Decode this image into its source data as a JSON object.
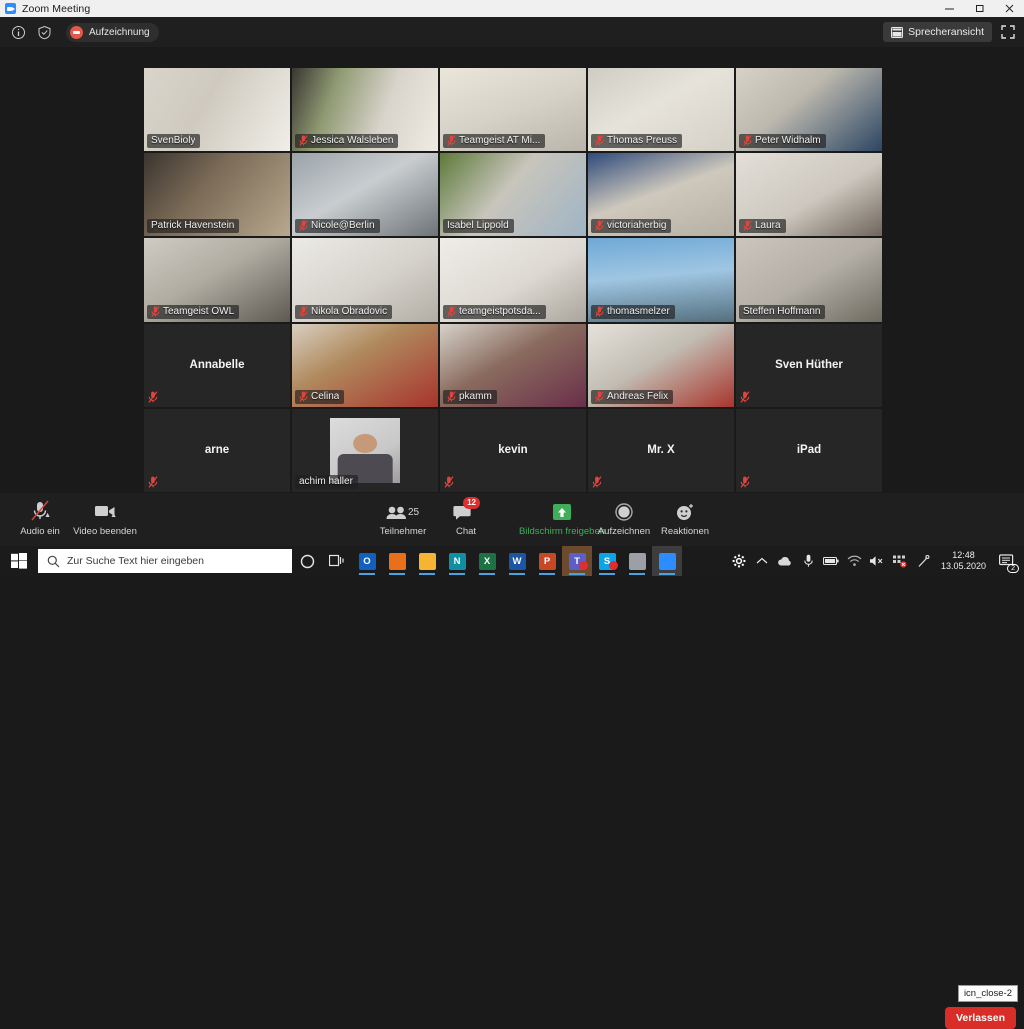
{
  "window": {
    "title": "Zoom Meeting",
    "app_icon": "zoom-icon",
    "minimize": "minimize-icon",
    "maximize": "maximize-icon",
    "close": "close-icon"
  },
  "topbar": {
    "info_icon": "info-icon",
    "shield_icon": "shield-icon",
    "recording_label": "Aufzeichnung",
    "speaker_view_label": "Sprecheransicht",
    "fullscreen_icon": "fullscreen-icon"
  },
  "grid": {
    "columns": 5,
    "rows": 5,
    "active_speaker": "Isabel Lippold",
    "active_border_color": "#b4e832",
    "tiles": [
      {
        "name": "SvenBioly",
        "muted": false,
        "video": true,
        "bg": "linear-gradient(120deg,#d9d5cc 0%,#cfcabf 42%,#f0eee8 100%)"
      },
      {
        "name": "Jessica Walsleben",
        "muted": true,
        "video": true,
        "bg": "linear-gradient(110deg,#3a3632 0%,#8f9a72 28%,#d8d3cb 62%,#efeae2 100%)"
      },
      {
        "name": "Teamgeist AT Mi...",
        "muted": true,
        "video": true,
        "bg": "linear-gradient(160deg,#eae6da 0%,#d6d2c8 50%,#b9b5ab 100%)"
      },
      {
        "name": "Thomas Preuss",
        "muted": true,
        "video": true,
        "bg": "linear-gradient(150deg,#cfccc4 0%,#e6e3db 45%,#d4d0c6 100%)"
      },
      {
        "name": "Peter Widhalm",
        "muted": true,
        "video": true,
        "bg": "linear-gradient(140deg,#d6d2c8 0%,#bdb9ae 40%,#2c4664 100%)"
      },
      {
        "name": "Patrick Havenstein",
        "muted": false,
        "video": true,
        "bg": "linear-gradient(130deg,#3b3530 0%,#7a6a56 40%,#b8a88e 100%)"
      },
      {
        "name": "Nicole@Berlin",
        "muted": true,
        "video": true,
        "bg": "linear-gradient(150deg,#9aa3a8 0%,#c9cdd0 45%,#6d7478 100%)"
      },
      {
        "name": "Isabel Lippold",
        "muted": false,
        "video": true,
        "active": true,
        "bg": "linear-gradient(130deg,#5d7a3a 0%,#c8c5bc 45%,#9fb4c4 100%)"
      },
      {
        "name": "victoriaherbig",
        "muted": true,
        "video": true,
        "bg": "linear-gradient(160deg,#2f4a7a 0%,#cfc9bd 48%,#b5afa4 100%)"
      },
      {
        "name": "Laura",
        "muted": true,
        "video": true,
        "bg": "linear-gradient(150deg,#e3dfd8 0%,#cdc8bf 55%,#6f655c 100%)"
      },
      {
        "name": "Teamgeist OWL",
        "muted": true,
        "video": true,
        "bg": "linear-gradient(150deg,#cfcbc2 0%,#b0aca2 45%,#5e5a52 100%)"
      },
      {
        "name": "Nikola Obradovic",
        "muted": true,
        "video": true,
        "bg": "linear-gradient(150deg,#eceae5 0%,#d5d2cb 55%,#b2aea5 100%)"
      },
      {
        "name": "teamgeistpotsda...",
        "muted": true,
        "video": true,
        "bg": "linear-gradient(150deg,#efede8 0%,#ddd9d2 55%,#a9a59c 100%)"
      },
      {
        "name": "thomasmelzer",
        "muted": true,
        "video": true,
        "bg": "linear-gradient(175deg,#6fa8d6 0%,#9fc6e2 45%,#54707f 100%)"
      },
      {
        "name": "Steffen Hoffmann",
        "muted": false,
        "video": true,
        "bg": "linear-gradient(150deg,#cbc6bd 0%,#b4afa6 50%,#6d6a60 100%)"
      },
      {
        "name": "Annabelle",
        "muted": true,
        "video": false
      },
      {
        "name": "Celina",
        "muted": true,
        "video": true,
        "bg": "linear-gradient(150deg,#d8cfc0 0%,#b08a5e 40%,#a8342c 100%)"
      },
      {
        "name": "pkamm",
        "muted": true,
        "video": true,
        "bg": "linear-gradient(150deg,#d6d2ca 0%,#8a6b5e 45%,#6a2f4a 100%)"
      },
      {
        "name": "Andreas Felix",
        "muted": true,
        "video": true,
        "bg": "linear-gradient(150deg,#e6e2da 0%,#c2bdb3 45%,#a8352c 100%)"
      },
      {
        "name": "Sven Hüther",
        "muted": true,
        "video": false
      },
      {
        "name": "arne",
        "muted": true,
        "video": false
      },
      {
        "name": "achim haller",
        "muted": false,
        "video": true,
        "avatar": true,
        "bg": "linear-gradient(150deg,#dcdcdc 0%,#c8c8c8 60%,#9d9d9d 100%)"
      },
      {
        "name": "kevin",
        "muted": true,
        "video": false
      },
      {
        "name": "Mr. X",
        "muted": true,
        "video": false
      },
      {
        "name": "iPad",
        "muted": true,
        "video": false
      }
    ]
  },
  "toolbar": {
    "audio_label": "Audio ein",
    "audio_icon": "mic-off-icon",
    "video_label": "Video beenden",
    "video_icon": "camera-icon",
    "participants_label": "Teilnehmer",
    "participants_count": "25",
    "participants_icon": "people-icon",
    "chat_label": "Chat",
    "chat_icon": "chat-icon",
    "chat_badge": "12",
    "share_label": "Bildschirm freigeben",
    "share_icon": "share-screen-icon",
    "share_color": "#3fae5a",
    "record_label": "Aufzeichnen",
    "record_icon": "record-icon",
    "reactions_label": "Reaktionen",
    "reactions_icon": "smiley-icon",
    "leave_label": "Verlassen",
    "tooltip": "icn_close-2"
  },
  "taskbar": {
    "start_icon": "windows-start-icon",
    "search_placeholder": "Zur Suche Text hier eingeben",
    "search_icon": "search-icon",
    "cortana_icon": "cortana-icon",
    "taskview_icon": "task-view-icon",
    "apps": [
      {
        "name": "outlook-icon",
        "glyph": "O",
        "color": "#1160bf",
        "running": true
      },
      {
        "name": "firefox-icon",
        "glyph": "",
        "color": "#e8701a",
        "running": true
      },
      {
        "name": "file-explorer-icon",
        "glyph": "",
        "color": "#f5b431",
        "running": true
      },
      {
        "name": "onenote-icon",
        "glyph": "N",
        "color": "#0f8fa3",
        "running": true
      },
      {
        "name": "excel-icon",
        "glyph": "X",
        "color": "#1d7245",
        "running": true
      },
      {
        "name": "word-icon",
        "glyph": "W",
        "color": "#1b55a5",
        "running": true
      },
      {
        "name": "powerpoint-icon",
        "glyph": "P",
        "color": "#c84724",
        "running": true
      },
      {
        "name": "teams-icon",
        "glyph": "T",
        "color": "#5b5fc7",
        "running": true,
        "badge": true,
        "highlight": true
      },
      {
        "name": "skype-icon",
        "glyph": "S",
        "color": "#0aa5e8",
        "running": true,
        "badge": true
      },
      {
        "name": "ppt-window-icon",
        "glyph": "",
        "color": "#9aa0a6",
        "running": true
      },
      {
        "name": "zoom-icon",
        "glyph": "",
        "color": "#2d8cff",
        "running": true,
        "active": true
      }
    ],
    "tray": {
      "gear_icon": "gear-icon",
      "chevron_icon": "chevron-up-icon",
      "onedrive_icon": "onedrive-cloud-icon",
      "mic_icon": "microphone-icon",
      "battery_icon": "battery-icon",
      "wifi_icon": "wifi-icon",
      "volume_icon": "speaker-muted-icon",
      "network_icon": "network-error-icon",
      "pen_icon": "pen-icon",
      "time": "12:48",
      "date": "13.05.2020",
      "notification_icon": "notification-icon",
      "notification_count": "2"
    }
  }
}
